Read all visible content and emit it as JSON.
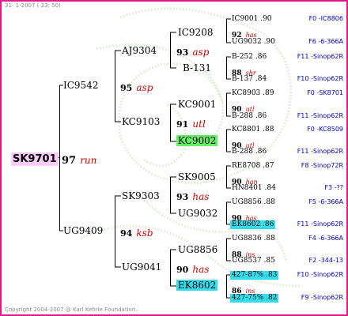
{
  "header": {
    "date_text": "31- 1-2007 ( 23: 50)"
  },
  "footer": {
    "copyright": "Copyright 2004-2007 @ Karl Kehrle Foundation."
  },
  "colors": {
    "border": "#e0188a",
    "highlight_pink": "#ffccff",
    "highlight_green": "#66ee66",
    "highlight_cyan": "#33ddee",
    "info_blue": "#0000cc",
    "colony_red": "#cc0000"
  },
  "root": {
    "id": "SK9701",
    "year": "97",
    "colony": "run"
  },
  "gen1": [
    {
      "id": "IC9542",
      "year": "95",
      "colony": "asp"
    },
    {
      "id": "UG9409",
      "year": "94",
      "colony": "ksb"
    }
  ],
  "gen2": [
    {
      "id": "AJ9304",
      "year": "93",
      "colony": "asp"
    },
    {
      "id": "KC9103",
      "year": "91",
      "colony": "utl"
    },
    {
      "id": "SK9303",
      "year": "93",
      "colony": "has"
    },
    {
      "id": "UG9041",
      "year": "90",
      "colony": "has"
    }
  ],
  "gen3": [
    {
      "id": "IC9208"
    },
    {
      "id": "B-131"
    },
    {
      "id": "KC9001"
    },
    {
      "id": "KC9002"
    },
    {
      "id": "SK9005"
    },
    {
      "id": "UG9032"
    },
    {
      "id": "UG8856"
    },
    {
      "id": "EK8602"
    }
  ],
  "gen4": [
    {
      "top": "IC9001 .90",
      "year": "92",
      "colony": "has",
      "bottom": "UG9032 .90",
      "info_top": "F0 -IC8806",
      "info_bottom": "F6 -6-366A"
    },
    {
      "top": "B-252 .86",
      "year": "88",
      "colony": "shr",
      "bottom": "B-137 .84",
      "info_top": "F11 -Sinop62R",
      "info_bottom": "F10 -Sinop62R"
    },
    {
      "top": "KC8903 .89",
      "year": "90",
      "colony": "utl",
      "bottom": "B-288 .86",
      "info_top": "F0 -SK8701",
      "info_bottom": "F11 -Sinop62R"
    },
    {
      "top": "KC8801 .88",
      "year": "90",
      "colony": "utl",
      "bottom": "B-288 .86",
      "info_top": "F0 -KC8509",
      "info_bottom": "F11 -Sinop62R"
    },
    {
      "top": "RE8708 .87",
      "year": "90",
      "colony": "han",
      "bottom": "HN8401 .84",
      "info_top": "F8 -Sinop72R",
      "info_bottom": "F3 -??"
    },
    {
      "top": "UG8856 .88",
      "year": "90",
      "colony": "has",
      "bottom": "EK8602 .86",
      "info_top": "F5 -6-366A",
      "info_bottom": "F11 -Sinop62R"
    },
    {
      "top": "UG8836 .88",
      "year": "88",
      "colony": "ins",
      "bottom": "UG8537 .85",
      "info_top": "F4 -6-366A",
      "info_bottom": "F2 -344-13"
    },
    {
      "top": "427-87% .83",
      "year": "86",
      "colony": "ins",
      "bottom": "427-75% .82",
      "info_top": "F10 -Sinop62R",
      "info_bottom": "F9 -Sinop62R"
    }
  ]
}
